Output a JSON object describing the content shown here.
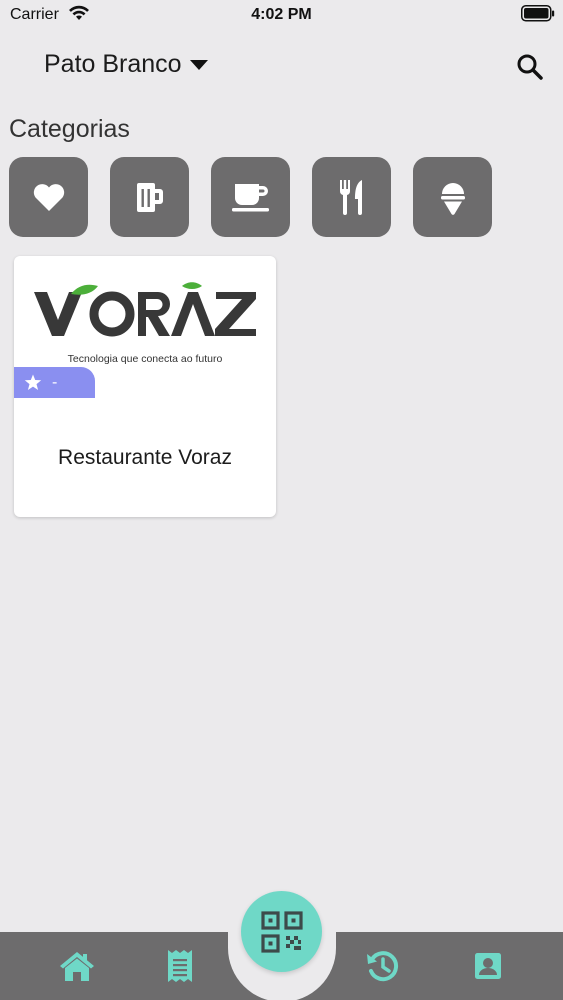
{
  "status_bar": {
    "carrier": "Carrier",
    "time": "4:02 PM"
  },
  "header": {
    "city": "Pato Branco"
  },
  "categories": {
    "title": "Categorias",
    "items": [
      {
        "icon": "heart-icon"
      },
      {
        "icon": "beer-mug-icon"
      },
      {
        "icon": "coffee-cup-icon"
      },
      {
        "icon": "fork-knife-icon"
      },
      {
        "icon": "ice-cream-icon"
      }
    ]
  },
  "restaurants": [
    {
      "logo_text": "VORAZ",
      "tagline": "Tecnologia que conecta ao futuro",
      "rating": "-",
      "name": "Restaurante Voraz"
    }
  ],
  "colors": {
    "background": "#ebeaec",
    "category_bg": "#6d6c6d",
    "rating_badge": "#8a8ff0",
    "accent": "#6fd8c7",
    "logo_green": "#4caf3a"
  },
  "bottom_nav": [
    "home-icon",
    "receipt-icon",
    "qr-code-icon",
    "history-icon",
    "profile-icon"
  ]
}
